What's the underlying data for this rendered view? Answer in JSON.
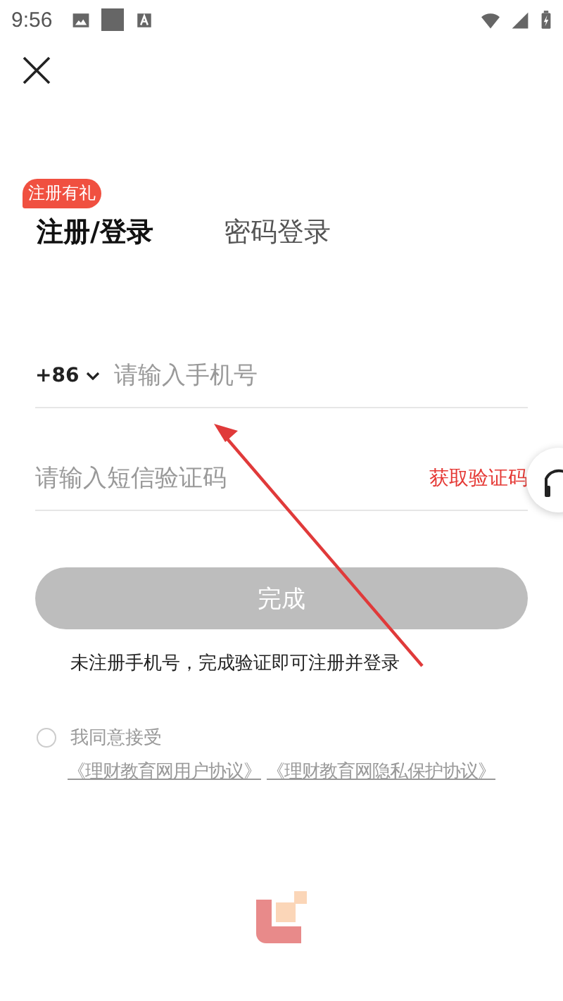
{
  "status_bar": {
    "time": "9:56"
  },
  "promo_badge": "注册有礼",
  "tabs": [
    {
      "label": "注册/登录",
      "selected": true
    },
    {
      "label": "密码登录",
      "selected": false
    }
  ],
  "phone": {
    "country_code": "+86",
    "placeholder": "请输入手机号"
  },
  "code": {
    "placeholder": "请输入短信验证码",
    "action": "获取验证码"
  },
  "submit": {
    "label": "完成",
    "disabled": true
  },
  "note": "未注册手机号，完成验证即可注册并登录",
  "agreement": {
    "checked": false,
    "label": "我同意接受",
    "links": [
      "《理财教育网用户协议》",
      "《理财教育网隐私保护协议》"
    ]
  }
}
